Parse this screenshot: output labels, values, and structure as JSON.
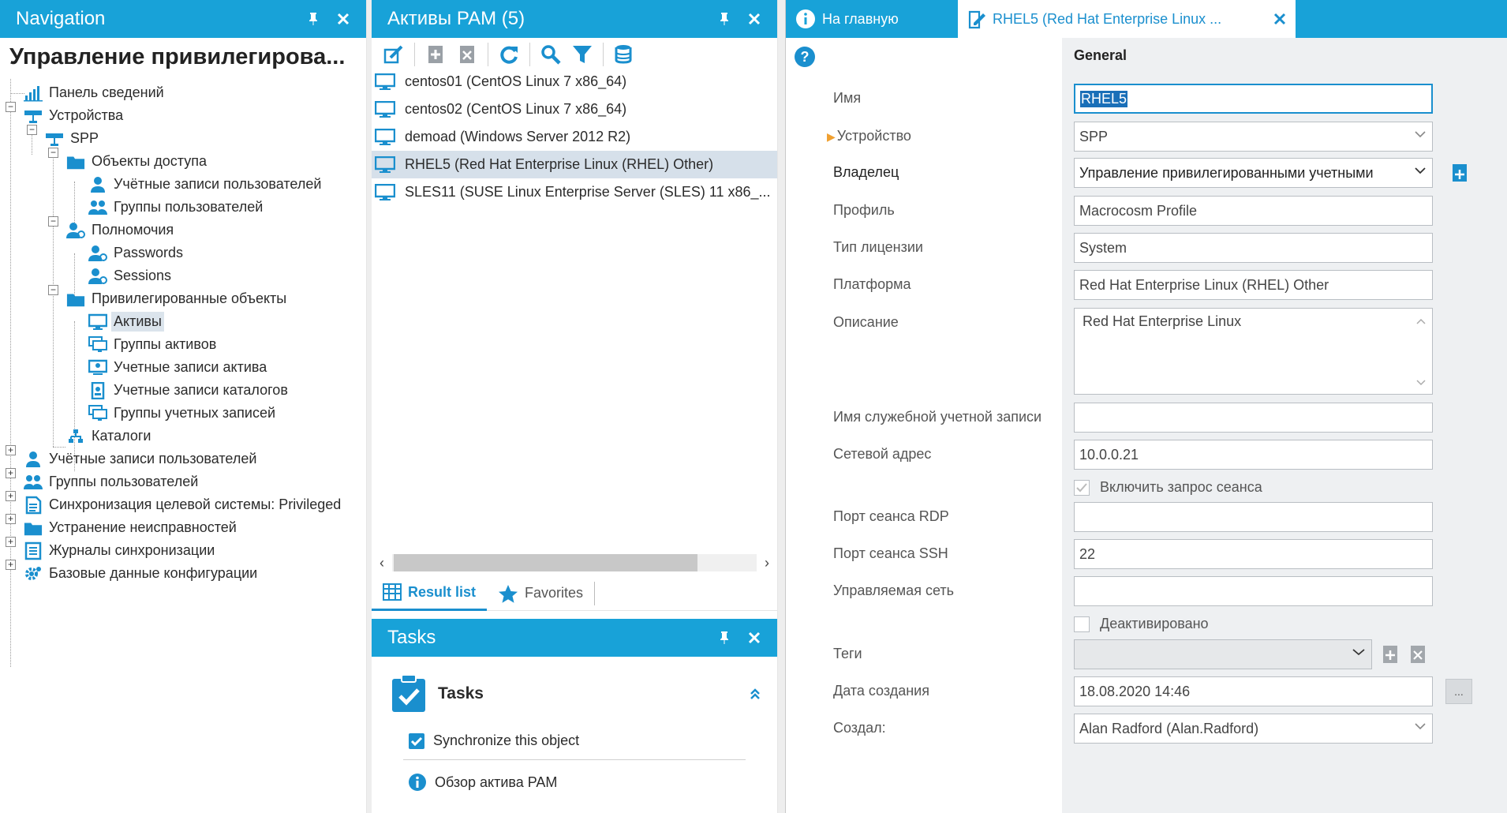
{
  "nav": {
    "title": "Navigation",
    "heading": "Управление привилегирова...",
    "items": [
      {
        "label": "Панель сведений"
      },
      {
        "label": "Устройства"
      },
      {
        "label": "SPP"
      },
      {
        "label": "Объекты доступа"
      },
      {
        "label": "Учётные записи пользователей"
      },
      {
        "label": "Группы пользователей"
      },
      {
        "label": "Полномочия"
      },
      {
        "label": "Passwords"
      },
      {
        "label": "Sessions"
      },
      {
        "label": "Привилегированные объекты"
      },
      {
        "label": "Активы"
      },
      {
        "label": "Группы активов"
      },
      {
        "label": "Учетные записи актива"
      },
      {
        "label": "Учетные записи каталогов"
      },
      {
        "label": "Группы учетных записей"
      },
      {
        "label": "Каталоги"
      },
      {
        "label": "Учётные записи пользователей"
      },
      {
        "label": "Группы пользователей"
      },
      {
        "label": "Синхронизация целевой системы: Privileged"
      },
      {
        "label": "Устранение неисправностей"
      },
      {
        "label": "Журналы синхронизации"
      },
      {
        "label": "Базовые данные конфигурации"
      }
    ]
  },
  "list": {
    "title": "Активы PAM (5)",
    "items": [
      {
        "label": "centos01 (CentOS Linux 7 x86_64)"
      },
      {
        "label": "centos02 (CentOS Linux 7 x86_64)"
      },
      {
        "label": "demoad (Windows Server 2012 R2)"
      },
      {
        "label": "RHEL5 (Red Hat Enterprise Linux (RHEL) Other)"
      },
      {
        "label": "SLES11 (SUSE Linux Enterprise Server (SLES) 11 x86_..."
      }
    ],
    "tab_result": "Result list",
    "tab_favorites": "Favorites"
  },
  "tasks": {
    "title": "Tasks",
    "section": "Tasks",
    "items": [
      {
        "label": "Synchronize this object"
      },
      {
        "label": "Обзор актива PAM"
      }
    ]
  },
  "detail": {
    "tab_home": "На главную",
    "tab_doc": "RHEL5 (Red Hat Enterprise Linux ...",
    "section": "General",
    "labels": {
      "name": "Имя",
      "device": "Устройство",
      "owner": "Владелец",
      "profile": "Профиль",
      "license": "Тип лицензии",
      "platform": "Платформа",
      "description": "Описание",
      "service_account": "Имя служебной учетной записи",
      "address": "Сетевой адрес",
      "enable_session": "Включить запрос сеанса",
      "rdp_port": "Порт сеанса RDP",
      "ssh_port": "Порт сеанса SSH",
      "managed_net": "Управляемая сеть",
      "disabled": "Деактивировано",
      "tags": "Теги",
      "created": "Дата создания",
      "created_by": "Создал:"
    },
    "values": {
      "name": "RHEL5",
      "device": "SPP",
      "owner": "Управление привилегированными учетными",
      "profile": "Macrocosm Profile",
      "license": "System",
      "platform": "Red Hat Enterprise Linux (RHEL) Other",
      "description": "Red Hat Enterprise Linux",
      "service_account": "",
      "address": "10.0.0.21",
      "rdp_port": "",
      "ssh_port": "22",
      "managed_net": "",
      "tags": "",
      "created": "18.08.2020 14:46",
      "created_by": "Alan Radford (Alan.Radford)",
      "ellipsis": "..."
    }
  },
  "colors": {
    "accent": "#18a2d8",
    "link": "#1a8fce",
    "selected": "#d6e0ea"
  }
}
